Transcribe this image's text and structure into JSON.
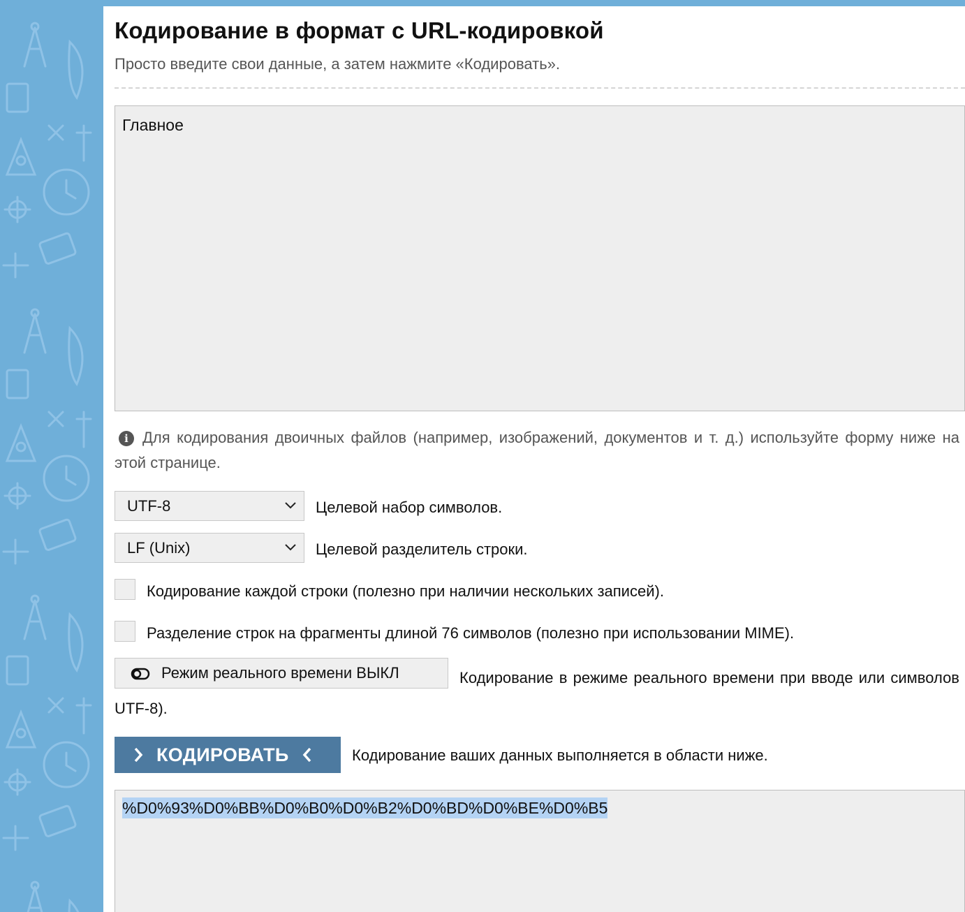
{
  "page": {
    "title": "Кодирование в формат с URL-кодировкой",
    "subtitle": "Просто введите свои данные, а затем нажмите «Кодировать»."
  },
  "input": {
    "value": "Главное"
  },
  "info": {
    "icon": "info-circle-icon",
    "text": "Для кодирования двоичных файлов (например, изображений, документов и т. д.) используйте форму ниже на этой странице."
  },
  "options": {
    "charset_value": "UTF-8",
    "charset_label": "Целевой набор символов.",
    "newline_value": "LF (Unix)",
    "newline_label": "Целевой разделитель строки.",
    "each_line_label": "Кодирование каждой строки (полезно при наличии нескольких записей).",
    "each_line_checked": false,
    "split_lines_label": "Разделение строк на фрагменты длиной 76 символов (полезно при использовании MIME).",
    "split_lines_checked": false
  },
  "realtime": {
    "button_label": "Режим реального времени ВЫКЛ",
    "description": "Кодирование в режиме реального времени при вводе или символов UTF-8)."
  },
  "encode": {
    "button_label": "КОДИРОВАТЬ",
    "label": "Кодирование ваших данных выполняется в области ниже."
  },
  "output": {
    "value": "%D0%93%D0%BB%D0%B0%D0%B2%D0%BD%D0%BE%D0%B5"
  },
  "colors": {
    "sidebar": "#6fafd9",
    "encode_button": "#4d7aa0",
    "selection": "#b4d3f4"
  }
}
